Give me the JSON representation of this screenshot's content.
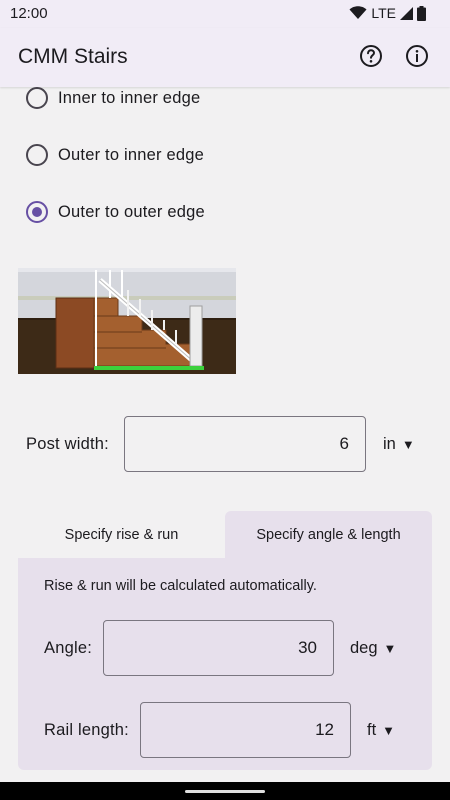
{
  "status_bar": {
    "time": "12:00",
    "network": "LTE"
  },
  "app_bar": {
    "title": "CMM Stairs",
    "help_icon": "help-circle-icon",
    "info_icon": "info-circle-icon"
  },
  "edge_options": [
    {
      "label": "Inner to inner edge",
      "selected": false
    },
    {
      "label": "Outer to inner edge",
      "selected": false
    },
    {
      "label": "Outer to outer edge",
      "selected": true
    }
  ],
  "post_width": {
    "label": "Post width:",
    "value": "6",
    "unit": "in",
    "unit_arrow": "▼"
  },
  "tabs": [
    {
      "label": "Specify rise & run",
      "selected": false
    },
    {
      "label": "Specify angle & length",
      "selected": true
    }
  ],
  "panel": {
    "note": "Rise & run will be calculated automatically.",
    "angle": {
      "label": "Angle:",
      "value": "30",
      "unit": "deg",
      "unit_arrow": "▼"
    },
    "rail_length": {
      "label": "Rail length:",
      "value": "12",
      "unit": "ft",
      "unit_arrow": "▼"
    }
  },
  "colors": {
    "accent": "#6750a4",
    "app_bar": "#f1ecf6",
    "panel": "#e7e0ec",
    "background": "#f2f1f2"
  }
}
